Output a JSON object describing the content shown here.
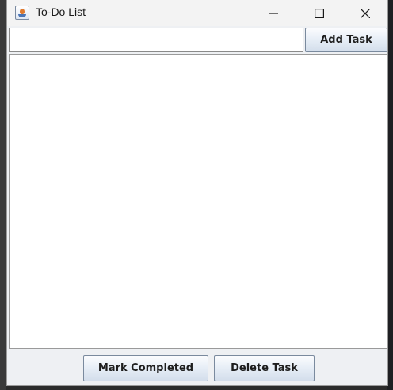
{
  "window": {
    "title": "To-Do List",
    "icon": "java-coffee-cup-icon"
  },
  "titlebar_controls": {
    "minimize_icon": "minimize-icon",
    "maximize_icon": "maximize-icon",
    "close_icon": "close-icon"
  },
  "task_entry": {
    "value": "",
    "placeholder": ""
  },
  "buttons": {
    "add_task": "Add Task",
    "mark_completed": "Mark Completed",
    "delete_task": "Delete Task"
  },
  "task_list": {
    "items": []
  }
}
